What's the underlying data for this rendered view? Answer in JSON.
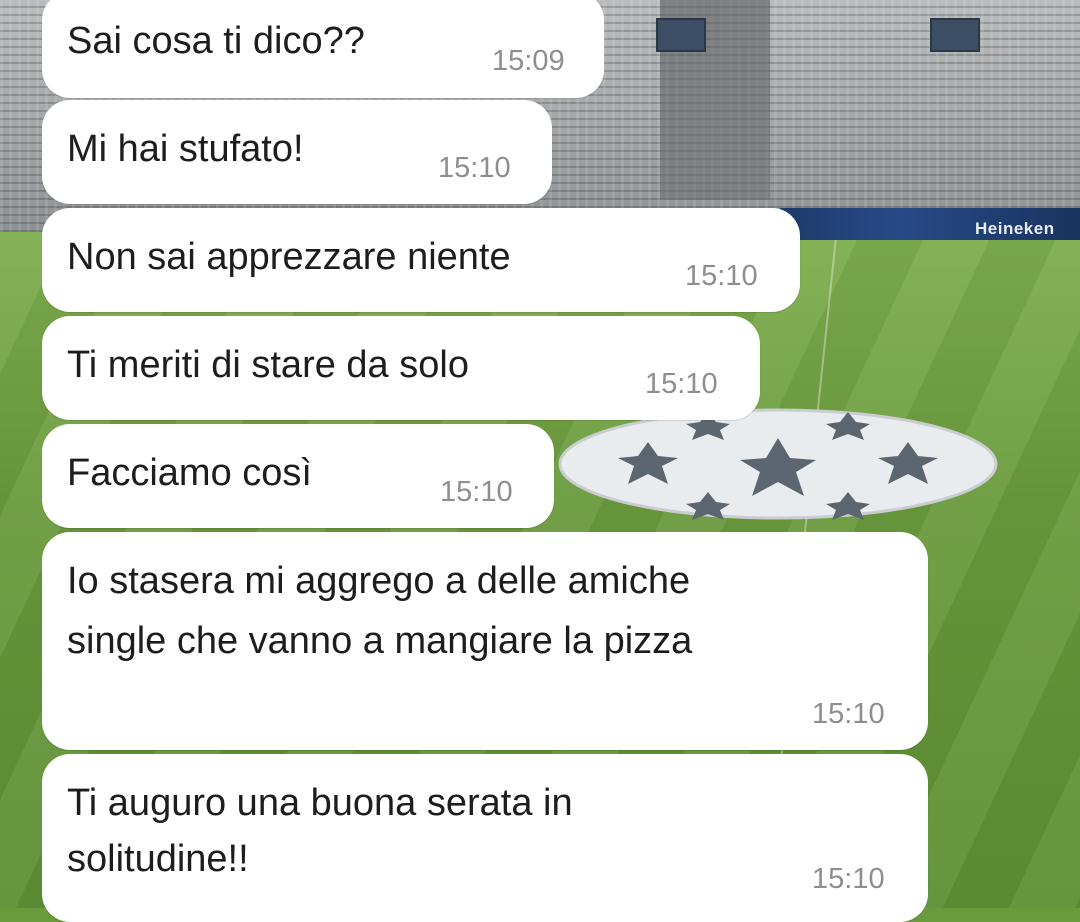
{
  "chat": {
    "messages": [
      {
        "text": "Sai cosa ti dico??",
        "time": "15:09"
      },
      {
        "text": "Mi hai stufato!",
        "time": "15:10"
      },
      {
        "text": "Non sai apprezzare niente",
        "time": "15:10"
      },
      {
        "text": "Ti meriti di stare da solo",
        "time": "15:10"
      },
      {
        "text": "Facciamo così",
        "time": "15:10"
      },
      {
        "text": "Io stasera mi aggrego a delle amiche single che vanno a mangiare la pizza",
        "line1": "Io stasera mi aggrego a delle amiche",
        "line2": "single che vanno a mangiare la pizza",
        "time": "15:10"
      },
      {
        "text": "Ti auguro una buona serata in solitudine!!",
        "line1": "Ti auguro una buona serata in",
        "line2": "solitudine!!",
        "time": "15:10"
      }
    ]
  },
  "wallpaper": {
    "ad_text": "Heineken",
    "colors": {
      "pitch": "#6a9a3c",
      "stands": "#a7a9ab",
      "bubble": "#ffffff",
      "time": "#8e8e8e"
    }
  }
}
